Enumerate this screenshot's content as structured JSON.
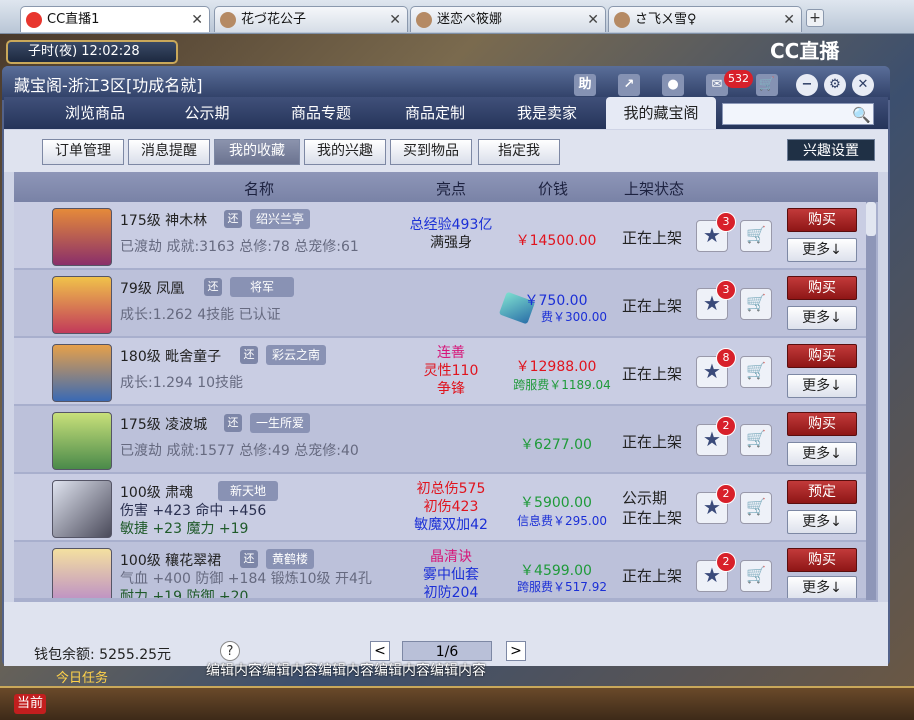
{
  "browser": {
    "tabs": [
      {
        "title": "CC直播1",
        "active": true
      },
      {
        "title": "花づ花公子",
        "active": false
      },
      {
        "title": "迷恋ぺ筱娜",
        "active": false
      },
      {
        "title": "さ飞ㄨ雪♀",
        "active": false
      }
    ]
  },
  "game": {
    "time": "子时(夜)  12:02:28",
    "logo": "CC直播",
    "task_label": "今日任务",
    "current_label": "当前",
    "overlay_text": "编辑内容编辑内容编辑内容编辑内容编辑内容"
  },
  "panel": {
    "title": "藏宝阁-浙江3区[功成名就]",
    "header_buttons": {
      "help": "助",
      "share": "↗",
      "record": "●",
      "mail_count": "532",
      "minimize": "−",
      "settings": "⚙",
      "close": "✕"
    },
    "tabs": [
      "浏览商品",
      "公示期",
      "商品专题",
      "商品定制",
      "我是卖家",
      "我的藏宝阁"
    ],
    "active_tab": "我的藏宝阁",
    "search_placeholder": "",
    "sub_buttons": [
      "订单管理",
      "消息提醒",
      "我的收藏",
      "我的兴趣",
      "买到物品",
      "指定我"
    ],
    "active_sub": "我的收藏",
    "interest_settings": "兴趣设置",
    "columns": [
      "名称",
      "亮点",
      "价钱",
      "上架状态"
    ],
    "rows": [
      {
        "level_name": "175级  神木林",
        "tag": "绍兴兰亭",
        "line2": "已渡劫 成就:3163 总修:78 总宠修:61",
        "line3": "",
        "highlights": [
          "总经验493亿",
          "满强身"
        ],
        "price": "￥14500.00",
        "fee": "",
        "status": "正在上架",
        "status2": "",
        "fav_count": "3",
        "action": "购买",
        "more": "更多↓"
      },
      {
        "level_name": "79级  凤凰",
        "tag": "将军",
        "line2": "成长:1.262 4技能 已认证",
        "line3": "",
        "highlights": [],
        "price": "￥750.00",
        "fee": "费￥300.00",
        "status": "正在上架",
        "status2": "",
        "fav_count": "3",
        "action": "购买",
        "more": "更多↓"
      },
      {
        "level_name": "180级  毗舍童子",
        "tag": "彩云之南",
        "line2": "成长:1.294 10技能",
        "line3": "",
        "highlights": [
          "连善",
          "灵性110",
          "争锋"
        ],
        "price": "￥12988.00",
        "fee": "跨服费￥1189.04",
        "status": "正在上架",
        "status2": "",
        "fav_count": "8",
        "action": "购买",
        "more": "更多↓"
      },
      {
        "level_name": "175级  凌波城",
        "tag": "一生所爱",
        "line2": "已渡劫 成就:1577 总修:49 总宠修:40",
        "line3": "",
        "highlights": [],
        "price": "￥6277.00",
        "fee": "",
        "status": "正在上架",
        "status2": "",
        "fav_count": "2",
        "action": "购买",
        "more": "更多↓"
      },
      {
        "level_name": "100级  肃魂",
        "tag": "新天地",
        "line2": "伤害 +423 命中 +456",
        "line3": "敏捷 +23 魔力 +19",
        "highlights": [
          "初总伤575",
          "初伤423",
          "敏魔双加42"
        ],
        "price": "￥5900.00",
        "fee": "信息费￥295.00",
        "status": "公示期",
        "status2": "正在上架",
        "fav_count": "2",
        "action": "预定",
        "more": "更多↓"
      },
      {
        "level_name": "100级  穰花翠裙",
        "tag": "黄鹤楼",
        "line2": "气血 +400 防御 +184 锻炼10级 开4孔",
        "line3": "耐力 +19 防御 +20",
        "highlights": [
          "晶清诀",
          "雾中仙套",
          "初防204"
        ],
        "price": "￥4599.00",
        "fee": "跨服费￥517.92",
        "status": "正在上架",
        "status2": "",
        "fav_count": "2",
        "action": "购买",
        "more": "更多↓"
      }
    ],
    "wallet": "钱包余额: 5255.25元",
    "help": "?",
    "page": "1/6",
    "prev": "<",
    "next": ">"
  },
  "colors": {
    "price_red": "#e0141e",
    "price_green": "#1f9a3a",
    "highlight_red": "#e0141e",
    "highlight_blue": "#1b2fd6",
    "highlight_pink": "#d6177a",
    "buy_button": "#a82424"
  }
}
